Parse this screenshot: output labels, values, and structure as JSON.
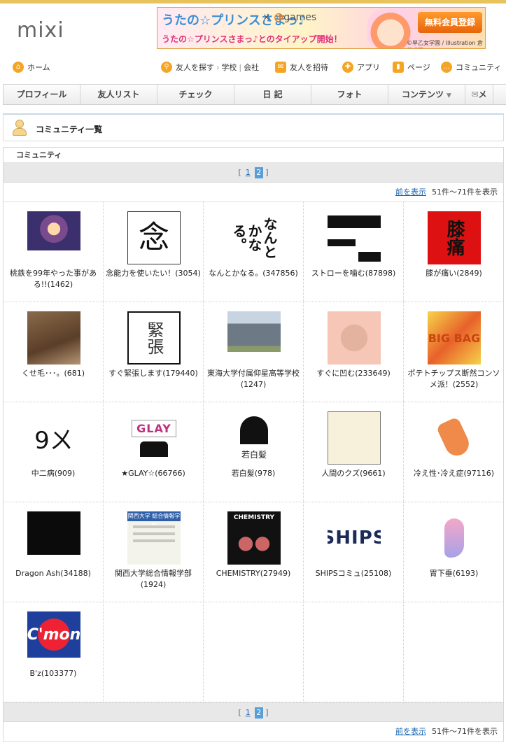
{
  "logo": "mixi",
  "banner": {
    "title": "うたの☆プリンスさまっ♪",
    "x": "×",
    "games_at": "@",
    "games": "games",
    "subtitle": "うたの☆プリンスさまっ♪とのタイアップ開始！",
    "button": "無料会員登録",
    "credit": "©早乙女学園 / Illustration 倉花千夏"
  },
  "subnav": {
    "home": "ホーム",
    "find_friends": "友人を探す",
    "school": "学校",
    "company": "会社",
    "invite": "友人を招待",
    "apps": "アプリ",
    "page": "ページ",
    "community": "コミュニティ"
  },
  "gnav": [
    "プロフィール",
    "友人リスト",
    "チェック",
    "日 記",
    "フォト",
    "コンテンツ",
    "メ"
  ],
  "page_title": "コミュニティ一覧",
  "section_title": "コミュニティ",
  "pager": {
    "open": "[",
    "close": "]",
    "pages": [
      "1",
      "2"
    ],
    "current": "2"
  },
  "pinfo": {
    "prev": "前を表示",
    "range": "51件～71件を表示"
  },
  "communities": [
    {
      "name": "桃鉄を99年やった事がある!!(1462)"
    },
    {
      "name": "念能力を使いたい！(3054)",
      "thumb_text": "念"
    },
    {
      "name": "なんとかなる。(347856)",
      "thumb_text": "なんとかなる。"
    },
    {
      "name": "ストローを噛む(87898)"
    },
    {
      "name": "膝が痛い(2849)",
      "thumb_text": "膝痛"
    },
    {
      "name": "くせ毛･･･。(681)"
    },
    {
      "name": "すぐ緊張します(179440)",
      "thumb_text": "緊張"
    },
    {
      "name": "東海大学付属仰星高等学校(1247)"
    },
    {
      "name": "すぐに凹む(233649)"
    },
    {
      "name": "ポテトチップス断然コンソメ派！(2552)",
      "thumb_text": "BIG BAG"
    },
    {
      "name": "中二病(909)",
      "thumb_text": "9ㄨ"
    },
    {
      "name": "★GLAY☆(66766)",
      "thumb_text": "GLAY"
    },
    {
      "name": "若白髪(978)",
      "thumb_text": "若白髪"
    },
    {
      "name": "人間のクズ(9661)"
    },
    {
      "name": "冷え性･冷え症(97116)"
    },
    {
      "name": "Dragon Ash(34188)"
    },
    {
      "name": "関西大学総合情報学部(1924)",
      "thumb_text": "関西大学 総合情報学部"
    },
    {
      "name": "CHEMISTRY(27949)",
      "thumb_text": "CHEMISTRY"
    },
    {
      "name": "SHIPSコミュ(25108)",
      "thumb_text": "SHIPS"
    },
    {
      "name": "胃下垂(6193)"
    },
    {
      "name": "B'z(103377)",
      "thumb_text": "C'mon"
    }
  ]
}
